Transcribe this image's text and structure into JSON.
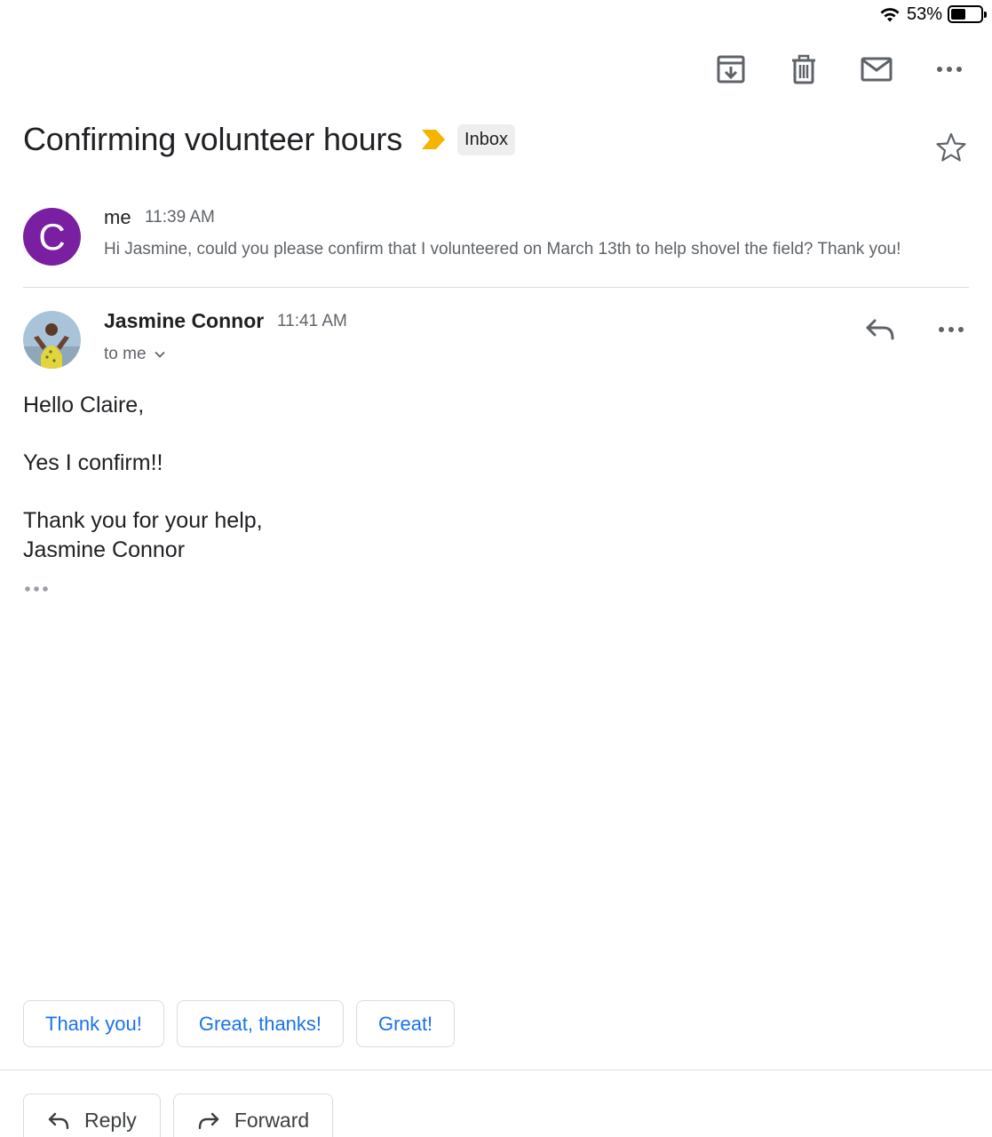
{
  "status_bar": {
    "battery_percent": "53%",
    "icons": [
      "wifi-icon",
      "battery-icon"
    ]
  },
  "toolbar": {
    "icons": [
      "archive-icon",
      "trash-icon",
      "mark-unread-icon",
      "more-horizontal-icon"
    ]
  },
  "email": {
    "subject": "Confirming volunteer hours",
    "label": "Inbox",
    "importance_color": "#f4b400"
  },
  "messages": [
    {
      "sender": "me",
      "avatar_letter": "C",
      "avatar_color": "#7b1fa2",
      "time": "11:39 AM",
      "snippet": "Hi Jasmine, could you please confirm that I volunteered on March 13th to help shovel the field? Thank you!"
    },
    {
      "sender": "Jasmine Connor",
      "time": "11:41 AM",
      "recipients": "to me",
      "body": {
        "greeting": "Hello Claire,",
        "line1": "Yes I confirm!!",
        "closing": "Thank you for your help,",
        "signature": "Jasmine Connor"
      }
    }
  ],
  "smart_replies": [
    "Thank you!",
    "Great, thanks!",
    "Great!"
  ],
  "actions": {
    "reply": "Reply",
    "forward": "Forward"
  },
  "colors": {
    "accent": "#1a73e8",
    "divider": "#dadce0",
    "secondary_text": "#5f6368"
  }
}
